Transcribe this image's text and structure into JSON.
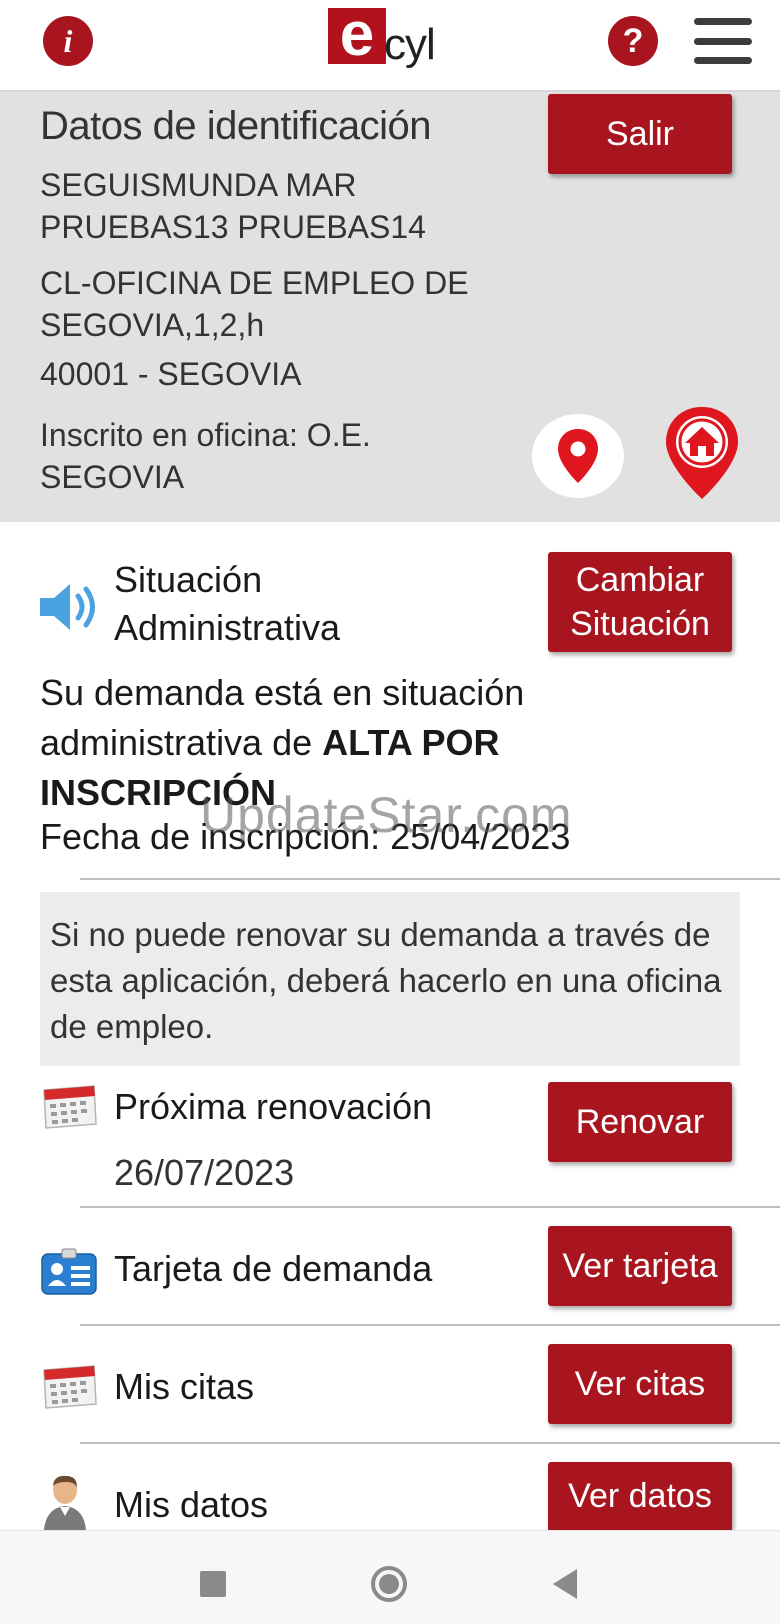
{
  "header": {
    "logo_letter": "e",
    "logo_text": "cyl",
    "info_glyph": "i",
    "help_glyph": "?",
    "icons": {
      "info": "info-icon",
      "help": "help-icon",
      "menu": "hamburger-menu-icon"
    }
  },
  "identification": {
    "title": "Datos de identificación",
    "name": "SEGUISMUNDA MAR PRUEBAS13 PRUEBAS14",
    "address": "CL-OFICINA DE EMPLEO DE SEGOVIA,1,2,h",
    "postal": "40001 - SEGOVIA",
    "office": "Inscrito en oficina: O.E. SEGOVIA",
    "logout_label": "Salir",
    "icons": {
      "location": "map-pin-icon",
      "home": "home-pin-icon"
    }
  },
  "situation": {
    "label_line1": "Situación",
    "label_line2": "Administrativa",
    "change_line1": "Cambiar",
    "change_line2": "Situación",
    "demand_prefix": "Su demanda está en situación administrativa de ",
    "demand_status": "ALTA POR INSCRIPCIÓN",
    "fecha": "Fecha de inscripción: 25/04/2023",
    "icon": "speaker-icon"
  },
  "watermark": "UpdateStar.com",
  "notice": "Si no puede renovar su demanda a través de esta aplicación, deberá hacerlo en una oficina de empleo.",
  "renewal": {
    "label": "Próxima renovación",
    "date": "26/07/2023",
    "button": "Renovar",
    "icon": "calendar-icon"
  },
  "card": {
    "label": "Tarjeta de demanda",
    "button": "Ver tarjeta",
    "icon": "id-card-icon"
  },
  "appointments": {
    "label": "Mis citas",
    "button": "Ver citas",
    "icon": "calendar-icon"
  },
  "mydata": {
    "label": "Mis datos",
    "button": "Ver datos",
    "icon": "user-avatar-icon"
  },
  "colors": {
    "accent": "#a8151f",
    "panel_bg": "#e1e1e1",
    "notice_bg": "#ececec",
    "speaker_blue": "#4aa3e0"
  }
}
